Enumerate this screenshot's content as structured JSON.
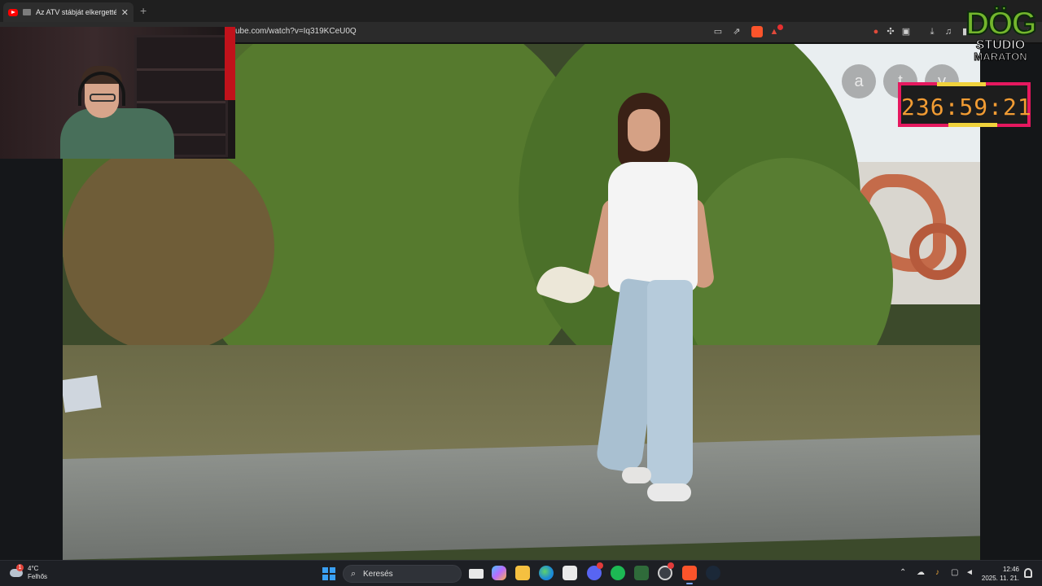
{
  "browser": {
    "tab_title": "Az ATV stábját elkergették, a",
    "tab_close": "✕",
    "new_tab": "+",
    "url": "ube.com/watch?v=Iq319KCeU0Q"
  },
  "video": {
    "overlay_buttons": [
      "a",
      "t",
      "y"
    ],
    "menu_dots": "•••"
  },
  "stream_overlay": {
    "logo_line1": "DÖG",
    "logo_line2": "STUDIO",
    "logo_line3": "MARATON",
    "timer": "236:59:21"
  },
  "taskbar": {
    "weather_temp": "4°C",
    "weather_desc": "Felhős",
    "weather_badge": "1",
    "search_placeholder": "Keresés",
    "clock_time": "12:46",
    "clock_date": "2025. 11. 21."
  },
  "colors": {
    "timer_border": "#e6185f",
    "timer_text": "#f29c33",
    "logo_green": "#74b62d",
    "windows_blue": "#3aa0f3"
  }
}
